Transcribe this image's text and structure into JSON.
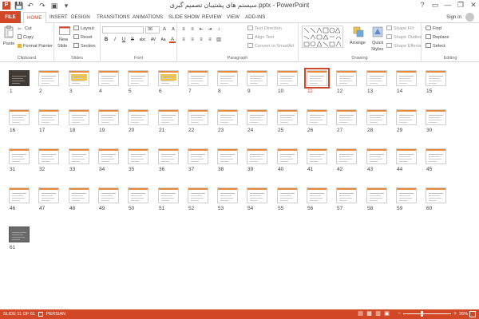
{
  "window": {
    "title": "سیستم های پشتیبان تصمیم گیری.pptx - PowerPoint",
    "app_icon": "P",
    "controls": [
      "?",
      "▭",
      "—",
      "❐",
      "✕"
    ],
    "quick_access": [
      "💾",
      "↶",
      "↷",
      "▣",
      "▾"
    ]
  },
  "tabs": {
    "file": "FILE",
    "home": "HOME",
    "insert": "INSERT",
    "design": "DESIGN",
    "transitions": "TRANSITIONS",
    "animations": "ANIMATIONS",
    "slideshow": "SLIDE SHOW",
    "review": "REVIEW",
    "view": "VIEW",
    "addins": "ADD-INS",
    "signin": "Sign in"
  },
  "ribbon": {
    "clipboard": {
      "label": "Clipboard",
      "paste": "Paste",
      "cut": "Cut",
      "copy": "Copy",
      "format_painter": "Format Painter"
    },
    "slides": {
      "label": "Slides",
      "new_slide": "New",
      "new_slide2": "Slide",
      "layout": "Layout",
      "reset": "Reset",
      "section": "Section"
    },
    "font": {
      "label": "Font",
      "size": "36",
      "bold": "B",
      "italic": "I",
      "underline": "U",
      "strike": "S",
      "clear": "abc",
      "spacing": "AV",
      "case": "Aa",
      "color": "A"
    },
    "paragraph": {
      "label": "Paragraph",
      "text_direction": "Text Direction",
      "align_text": "Align Text",
      "convert": "Convert to SmartArt"
    },
    "drawing": {
      "label": "Drawing",
      "arrange": "Arrange",
      "quick_styles": "Quick",
      "quick_styles2": "Styles",
      "shape_fill": "Shape Fill",
      "shape_outline": "Shape Outline",
      "shape_effects": "Shape Effects"
    },
    "editing": {
      "label": "Editing",
      "find": "Find",
      "replace": "Replace",
      "select": "Select"
    }
  },
  "slides": [
    "1",
    "2",
    "3",
    "4",
    "5",
    "6",
    "7",
    "8",
    "9",
    "10",
    "11",
    "12",
    "13",
    "14",
    "15",
    "16",
    "17",
    "18",
    "19",
    "20",
    "21",
    "22",
    "23",
    "24",
    "25",
    "26",
    "27",
    "28",
    "29",
    "30",
    "31",
    "32",
    "33",
    "34",
    "35",
    "36",
    "37",
    "38",
    "39",
    "40",
    "41",
    "42",
    "43",
    "44",
    "45",
    "46",
    "47",
    "48",
    "49",
    "50",
    "51",
    "52",
    "53",
    "54",
    "55",
    "56",
    "57",
    "58",
    "59",
    "60",
    "61"
  ],
  "selected_slide": 11,
  "status": {
    "slide_indicator": "SLIDE 11 OF 61",
    "language": "PERSIAN",
    "zoom": "26%",
    "zoom_minus": "−",
    "zoom_plus": "+",
    "views": [
      "▤",
      "▦",
      "▥",
      "▣"
    ]
  },
  "colors": {
    "accent": "#d24726",
    "slide_bar": "#e8883a"
  }
}
